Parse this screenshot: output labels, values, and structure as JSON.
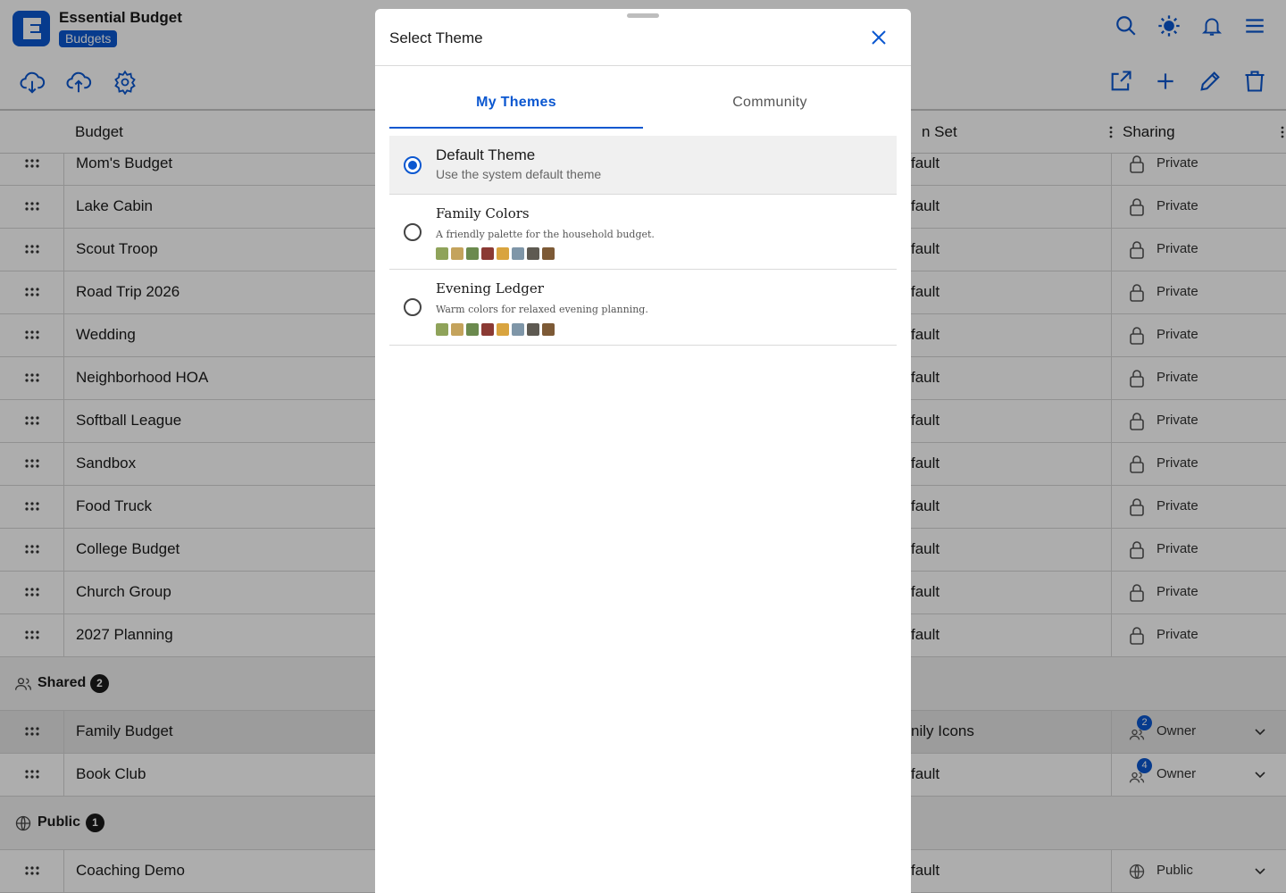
{
  "app": {
    "title": "Essential Budget",
    "badge": "Budgets"
  },
  "table": {
    "headers": {
      "budget": "Budget",
      "icon_set": "n Set",
      "sharing": "Sharing"
    },
    "private_rows": [
      {
        "name": "Mom's Budget",
        "set": "fault",
        "sharing": "Private"
      },
      {
        "name": "Lake Cabin",
        "set": "fault",
        "sharing": "Private"
      },
      {
        "name": "Scout Troop",
        "set": "fault",
        "sharing": "Private"
      },
      {
        "name": "Road Trip 2026",
        "set": "fault",
        "sharing": "Private"
      },
      {
        "name": "Wedding",
        "set": "fault",
        "sharing": "Private"
      },
      {
        "name": "Neighborhood HOA",
        "set": "fault",
        "sharing": "Private"
      },
      {
        "name": "Softball League",
        "set": "fault",
        "sharing": "Private"
      },
      {
        "name": "Sandbox",
        "set": "fault",
        "sharing": "Private"
      },
      {
        "name": "Food Truck",
        "set": "fault",
        "sharing": "Private"
      },
      {
        "name": "College Budget",
        "set": "fault",
        "sharing": "Private"
      },
      {
        "name": "Church Group",
        "set": "fault",
        "sharing": "Private"
      },
      {
        "name": "2027 Planning",
        "set": "fault",
        "sharing": "Private"
      }
    ],
    "groups": {
      "shared": {
        "label": "Shared",
        "count": "2"
      },
      "public": {
        "label": "Public",
        "count": "1"
      }
    },
    "shared_rows": [
      {
        "name": "Family Budget",
        "set": "nily Icons",
        "sharing": "Owner",
        "members": "2"
      },
      {
        "name": "Book Club",
        "set": "fault",
        "sharing": "Owner",
        "members": "4"
      }
    ],
    "public_rows": [
      {
        "name": "Coaching Demo",
        "set": "fault",
        "sharing": "Public"
      }
    ]
  },
  "modal": {
    "title": "Select Theme",
    "tabs": {
      "my_themes": "My Themes",
      "community": "Community"
    },
    "themes": [
      {
        "name": "Default Theme",
        "description": "Use the system default theme",
        "selected": true
      },
      {
        "name": "Family Colors",
        "description": "A friendly palette for the household budget.",
        "selected": false
      },
      {
        "name": "Evening Ledger",
        "description": "Warm colors for relaxed evening planning.",
        "selected": false
      }
    ],
    "palette": [
      "#8fa35a",
      "#c4a35c",
      "#6b8a4e",
      "#8b3a34",
      "#d9a43f",
      "#7f96a8",
      "#5e5a52",
      "#7d5a36"
    ]
  },
  "colors": {
    "accent": "#0b57d0"
  }
}
